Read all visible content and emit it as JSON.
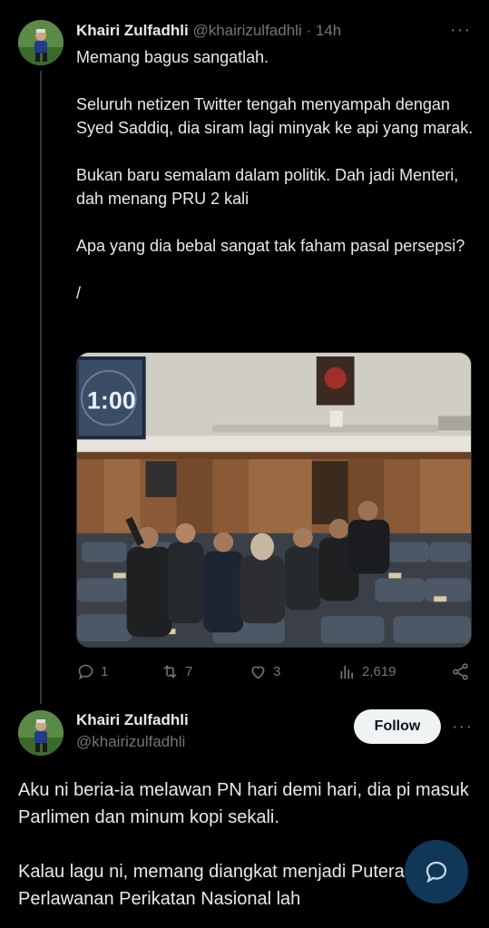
{
  "tweet1": {
    "author_name": "Khairi Zulfadhli",
    "handle": "@khairizulfadhli",
    "separator": "·",
    "time": "14h",
    "more_label": "···",
    "paragraphs": [
      "Memang bagus sangatlah.",
      "Seluruh netizen Twitter tengah menyampah dengan Syed Saddiq, dia siram lagi minyak ke api yang marak.",
      "Bukan baru semalam dalam politik. Dah jadi Menteri, dah menang PRU 2 kali",
      "Apa yang dia bebal sangat tak faham pasal persepsi?",
      "/"
    ],
    "media": {
      "clock_text": "1:00"
    },
    "actions": {
      "replies": "1",
      "reposts": "7",
      "likes": "3",
      "views": "2,619"
    }
  },
  "tweet2": {
    "author_name": "Khairi Zulfadhli",
    "handle": "@khairizulfadhli",
    "follow_label": "Follow",
    "more_label": "···",
    "paragraphs": [
      "Aku ni beria-ia melawan PN hari demi hari, dia pi masuk Parlimen dan minum kopi sekali.",
      "Kalau lagu ni, memang diangkat menjadi Putera Perlawanan Perikatan Nasional lah"
    ]
  },
  "colors": {
    "background": "#000000",
    "text_primary": "#e7e9ea",
    "text_secondary": "#71767b",
    "follow_bg": "#eff3f4",
    "fab_bg": "#1d64a0"
  },
  "icons": {
    "reply": "reply-icon",
    "repost": "repost-icon",
    "like": "heart-icon",
    "views": "views-icon",
    "share": "share-icon",
    "compose": "compose-icon"
  }
}
